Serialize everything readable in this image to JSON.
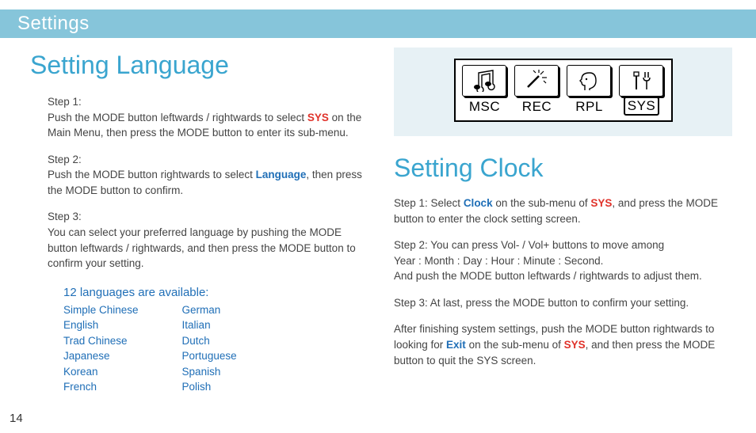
{
  "header": {
    "title": "Settings"
  },
  "page_number": "14",
  "left": {
    "title": "Setting Language",
    "step1_label": "Step 1:",
    "step1_pre": "Push the MODE button leftwards / rightwards to select ",
    "step1_hl": "SYS",
    "step1_post": " on the Main Menu, then press the MODE button to enter its sub-menu.",
    "step2_label": "Step 2:",
    "step2_pre": "Push the MODE button rightwards to select ",
    "step2_hl": "Language",
    "step2_post": ", then press the MODE button to confirm.",
    "step3_label": "Step 3:",
    "step3_body": "You can select your preferred language by pushing the MODE button leftwards / rightwards, and then press the MODE button to confirm your setting.",
    "lang_title": "12 languages are available:",
    "langs_col1": [
      "Simple Chinese",
      "English",
      "Trad Chinese",
      "Japanese",
      "Korean",
      "French"
    ],
    "langs_col2": [
      "German",
      "Italian",
      "Dutch",
      "Portuguese",
      "Spanish",
      "Polish"
    ]
  },
  "menu": {
    "items": [
      {
        "label": "MSC",
        "icon": "music-icon"
      },
      {
        "label": "REC",
        "icon": "wand-icon"
      },
      {
        "label": "RPL",
        "icon": "head-icon"
      },
      {
        "label": "SYS",
        "icon": "tools-icon"
      }
    ]
  },
  "right": {
    "title": "Setting Clock",
    "step1_pre": "Step 1: Select ",
    "step1_hl": "Clock",
    "step1_mid": " on the sub-menu of ",
    "step1_hl2": "SYS",
    "step1_post": ", and press the MODE button to enter the clock setting screen.",
    "step2_a": "Step 2: You can press Vol- / Vol+ buttons to move among",
    "step2_b": "Year : Month : Day : Hour : Minute : Second.",
    "step2_c": "And push the MODE button leftwards / rightwards to adjust them.",
    "step3": "Step 3: At last, press the MODE button to confirm your setting.",
    "after_pre": "After finishing system settings, push the MODE button rightwards to looking for ",
    "after_hl": "Exit",
    "after_mid": " on the sub-menu of ",
    "after_hl2": "SYS",
    "after_post": ", and then press the MODE button to quit the SYS screen."
  }
}
